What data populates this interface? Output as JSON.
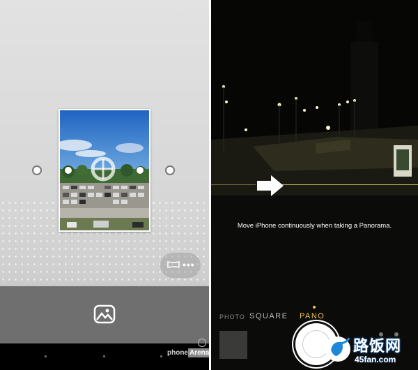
{
  "left_screen": {
    "mode_pill": {
      "icon": "panorama-icon",
      "more_label": "•••"
    },
    "gallery_button_icon": "gallery-icon",
    "watermark": {
      "part1": "phone",
      "part2": "Arena"
    }
  },
  "right_screen": {
    "instruction": "Move iPhone continuously when taking a Panorama.",
    "modes": [
      "PHOTO",
      "SQUARE",
      "PANO"
    ],
    "selected_mode": "PANO",
    "accent_color": "#f2c94c",
    "logo": {
      "name": "路饭网",
      "site": "45fan.com"
    }
  }
}
